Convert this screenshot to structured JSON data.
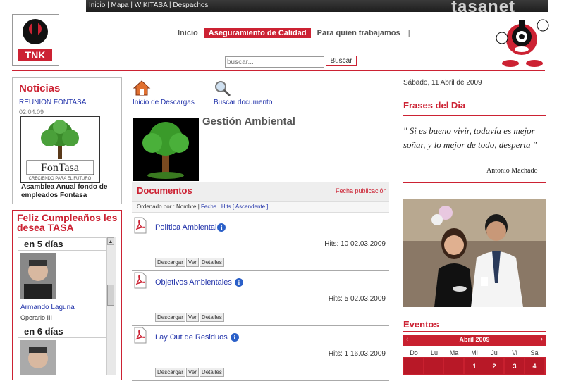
{
  "top_links": [
    "Inicio",
    "Mapa",
    "WIKITASA",
    "Despachos"
  ],
  "brand": "tasanet",
  "logo_text": "TNK",
  "nav": {
    "items": [
      "Inicio",
      "Aseguramiento de Calidad",
      "Para quien trabajamos"
    ],
    "active_index": 1
  },
  "search": {
    "placeholder": "buscar...",
    "button": "Buscar"
  },
  "news": {
    "title": "Noticias",
    "item_link": "REUNION FONTASA",
    "item_date": "02.04.09",
    "image_brand": "FonTasa",
    "image_tagline": "CRECIENDO PARA EL FUTURO",
    "caption": "Asamblea Anual fondo de empleados Fontasa"
  },
  "birthdays": {
    "title": "Feliz Cumpleaños les desea TASA",
    "sections": [
      {
        "heading": "en 5 días",
        "name": "Armando Laguna",
        "role": "Operario III"
      },
      {
        "heading": "en 6 días",
        "name": "",
        "role": ""
      }
    ]
  },
  "center": {
    "home_label": "Inicio de Descargas",
    "search_label": "Buscar documento",
    "section_title": "Gestión Ambiental",
    "docs_title": "Documentos",
    "date_column": "Fecha publicación",
    "sort": {
      "prefix": "Ordenado por : Nombre |",
      "fecha": "Fecha",
      "sep": "|",
      "hits": "Hits",
      "asc": "[ Ascendente ]"
    },
    "documents": [
      {
        "name": "Política Ambiental",
        "hits": "Hits: 10",
        "date": "02.03.2009"
      },
      {
        "name": "Objetivos Ambientales",
        "hits": "Hits: 5",
        "date": "02.03.2009"
      },
      {
        "name": "Lay Out de Residuos",
        "hits": "Hits: 1",
        "date": "16.03.2009"
      }
    ],
    "buttons": [
      "Descargar",
      "Ver",
      "Detalles"
    ]
  },
  "right": {
    "date": "Sábado, 11 Abril de 2009",
    "frases_title": "Frases del Dia",
    "quote": "\" Si es bueno vivir, todavía es mejor soñar, y lo mejor de todo, desperta \"",
    "author": "Antonio Machado",
    "eventos_title": "Eventos",
    "calendar": {
      "month": "Abril 2009",
      "prev": "‹",
      "next": "›",
      "days": [
        "Do",
        "Lu",
        "Ma",
        "Mi",
        "Ju",
        "Vi",
        "Sá"
      ],
      "first_row": [
        "",
        "",
        "",
        "1",
        "2",
        "3",
        "4"
      ]
    }
  },
  "colors": {
    "accent": "#cc2233",
    "link": "#2233aa"
  }
}
